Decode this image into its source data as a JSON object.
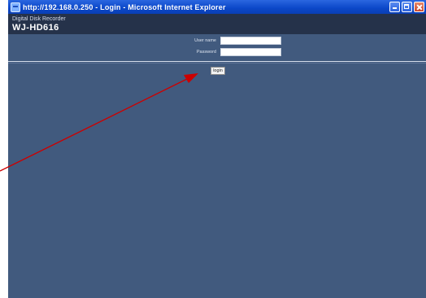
{
  "window": {
    "title": "http://192.168.0.250 - Login - Microsoft Internet Explorer"
  },
  "header": {
    "subtitle": "Digital Disk Recorder",
    "model": "WJ-HD616"
  },
  "login_form": {
    "username_label": "User name",
    "username_value": "",
    "password_label": "Password",
    "password_value": "",
    "login_label": "login"
  },
  "colors": {
    "page_background": "#415a7e",
    "header_background": "#25324a",
    "annotation_arrow": "#cc0000"
  },
  "icons": {
    "titlebar": "ie-icon",
    "minimize": "minimize-icon",
    "maximize": "maximize-icon",
    "close": "close-icon",
    "annotation": "annotation-arrow"
  }
}
